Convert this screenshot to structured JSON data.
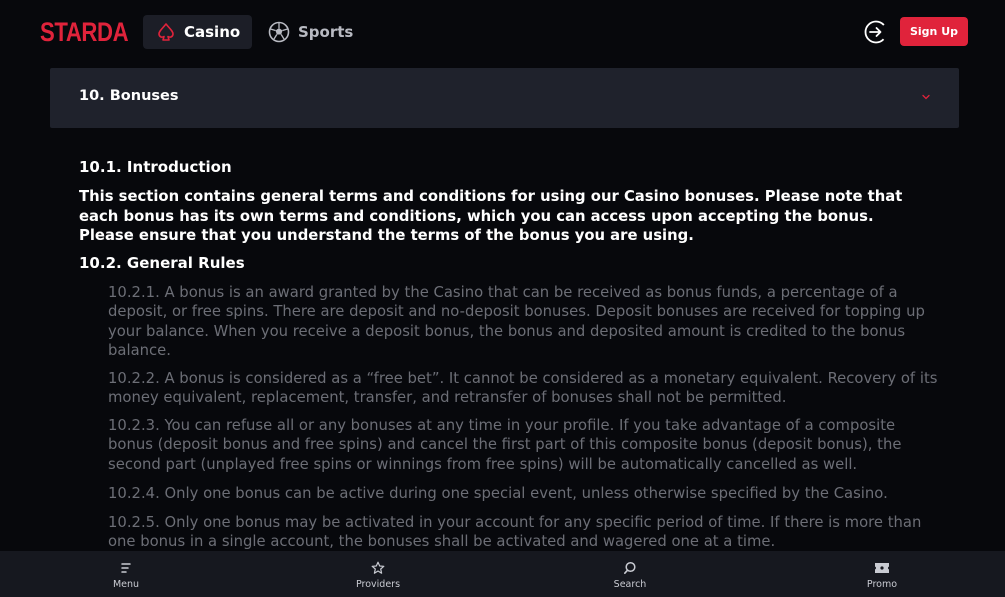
{
  "brand": {
    "logo_text": "STARDA",
    "accent": "#e0233b"
  },
  "nav": {
    "tabs": [
      {
        "label": "Casino",
        "icon": "spade-icon",
        "active": true
      },
      {
        "label": "Sports",
        "icon": "soccer-ball-icon",
        "active": false
      }
    ],
    "login_icon": "login-icon",
    "signup_label": "Sign Up"
  },
  "section": {
    "title": "10. Bonuses",
    "expand_icon": "chevron-down-icon",
    "intro_heading": "10.1.  Introduction",
    "intro_text": "This section contains general terms and conditions for using our Casino bonuses. Please note that each bonus has its own terms and conditions, which you can access upon accepting the bonus. Please ensure that you understand the terms of the bonus you are using.",
    "rules_heading": "10.2.  General Rules",
    "rules": [
      "10.2.1. A bonus is an award granted by the Casino that can be received as bonus funds, a percentage of a deposit, or free spins. There are deposit and no-deposit bonuses. Deposit bonuses are received for topping up your balance. When you receive a deposit bonus, the bonus and deposited amount is credited to the bonus balance.",
      "10.2.2. A bonus is considered as a “free bet”. It cannot be considered as a monetary equivalent. Recovery of its money equivalent, replacement, transfer, and retransfer of bonuses shall not be permitted.",
      "10.2.3. You can refuse all or any bonuses at any time in your profile. If you take advantage of a composite bonus (deposit bonus and free spins) and cancel the first part of this composite bonus (deposit bonus), the second part (unplayed free spins or winnings from free spins) will be automatically cancelled as well.",
      "10.2.4. Only one bonus can be active during one special event, unless otherwise specified by the Casino.",
      "10.2.5. Only one bonus may be activated in your account for any specific period of time. If there is more than one bonus in a single account, the bonuses shall be activated and wagered one at a time."
    ]
  },
  "bottom_nav": [
    {
      "label": "Menu",
      "icon": "menu-icon"
    },
    {
      "label": "Providers",
      "icon": "star-icon"
    },
    {
      "label": "Search",
      "icon": "search-icon"
    },
    {
      "label": "Promo",
      "icon": "ticket-icon"
    }
  ]
}
